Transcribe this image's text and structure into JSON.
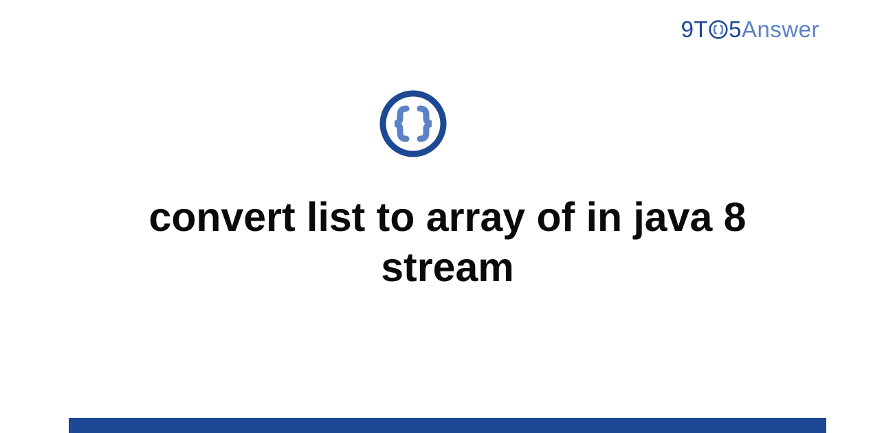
{
  "brand": {
    "part1": "9T",
    "part2": "5",
    "part3": "Answer"
  },
  "title": "convert list to array of in java 8 stream",
  "colors": {
    "primary": "#1d4894",
    "secondary": "#5b82c7"
  },
  "icons": {
    "main": "code-braces-icon",
    "logo": "code-braces-icon"
  }
}
